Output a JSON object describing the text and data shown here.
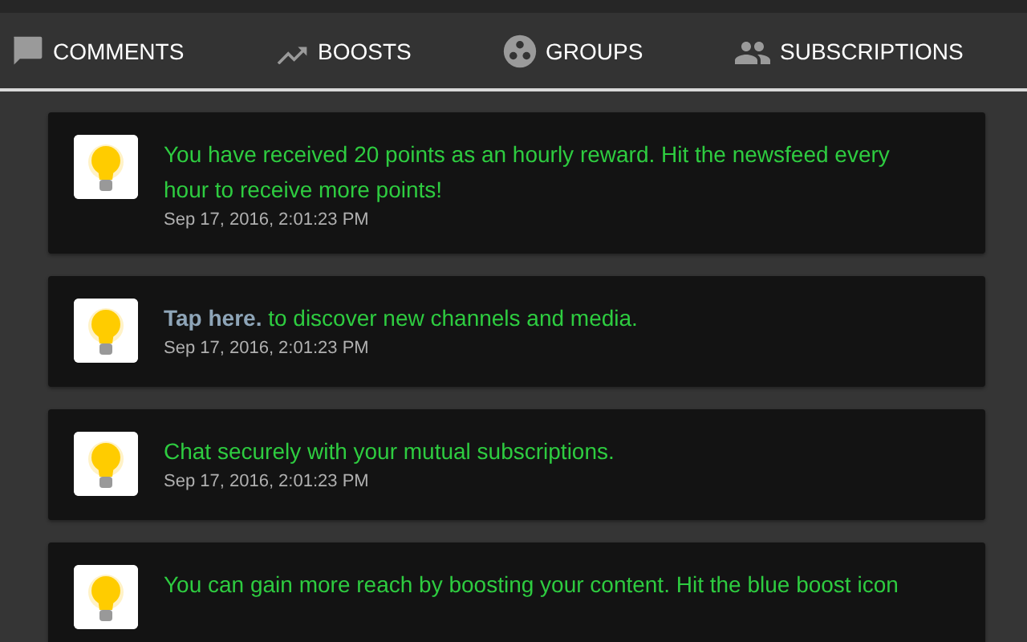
{
  "tabs": [
    {
      "label": "COMMENTS"
    },
    {
      "label": "BOOSTS"
    },
    {
      "label": "GROUPS"
    },
    {
      "label": "SUBSCRIPTIONS"
    }
  ],
  "notifications": [
    {
      "message": "You have received 20 points as an hourly reward. Hit the newsfeed every hour to receive more points!",
      "time": "Sep 17, 2016, 2:01:23 PM"
    },
    {
      "link": "Tap here.",
      "message": "to discover new channels and media.",
      "time": "Sep 17, 2016, 2:01:23 PM"
    },
    {
      "message": "Chat securely with your mutual subscriptions.",
      "time": "Sep 17, 2016, 2:01:23 PM"
    },
    {
      "message": "You can gain more reach by boosting your content. Hit the blue boost icon"
    }
  ]
}
